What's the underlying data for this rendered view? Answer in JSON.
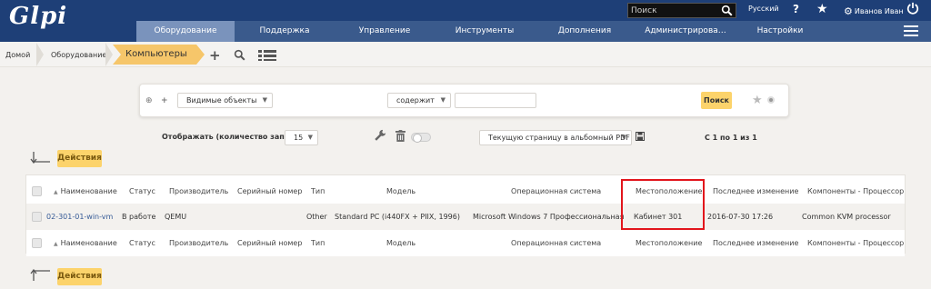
{
  "header": {
    "logo": "Glpi",
    "search_placeholder": "Поиск",
    "language": "Русский",
    "help": "?",
    "user": "Иванов Иван"
  },
  "menu": [
    {
      "label": "Оборудование",
      "active": true
    },
    {
      "label": "Поддержка"
    },
    {
      "label": "Управление"
    },
    {
      "label": "Инструменты"
    },
    {
      "label": "Дополнения"
    },
    {
      "label": "Администрирова…"
    },
    {
      "label": "Настройки"
    }
  ],
  "breadcrumb": {
    "home": "Домой",
    "section": "Оборудование",
    "current": "Компьютеры"
  },
  "search": {
    "field": "Видимые объекты",
    "operator": "содержит",
    "value": "",
    "button": "Поиск"
  },
  "controls": {
    "display_label": "Отображать (количество записей)",
    "per_page": "15",
    "export": "Текущую страницу в альбомный PDF",
    "pagination": "С 1 по 1 из 1"
  },
  "actions_label": "Действия",
  "table": {
    "columns": [
      "Наименование",
      "Статус",
      "Производитель",
      "Серийный номер",
      "Тип",
      "Модель",
      "Операционная система",
      "Местоположение",
      "Последнее изменение",
      "Компоненты - Процессор"
    ],
    "rows": [
      [
        "02-301-01-win-vm",
        "В работе",
        "QEMU",
        "",
        "Other",
        "Standard PC (i440FX + PIIX, 1996)",
        "Microsoft Windows 7 Профессиональная",
        "Кабинет 301",
        "2016-07-30 17:26",
        "Common KVM processor"
      ]
    ]
  }
}
